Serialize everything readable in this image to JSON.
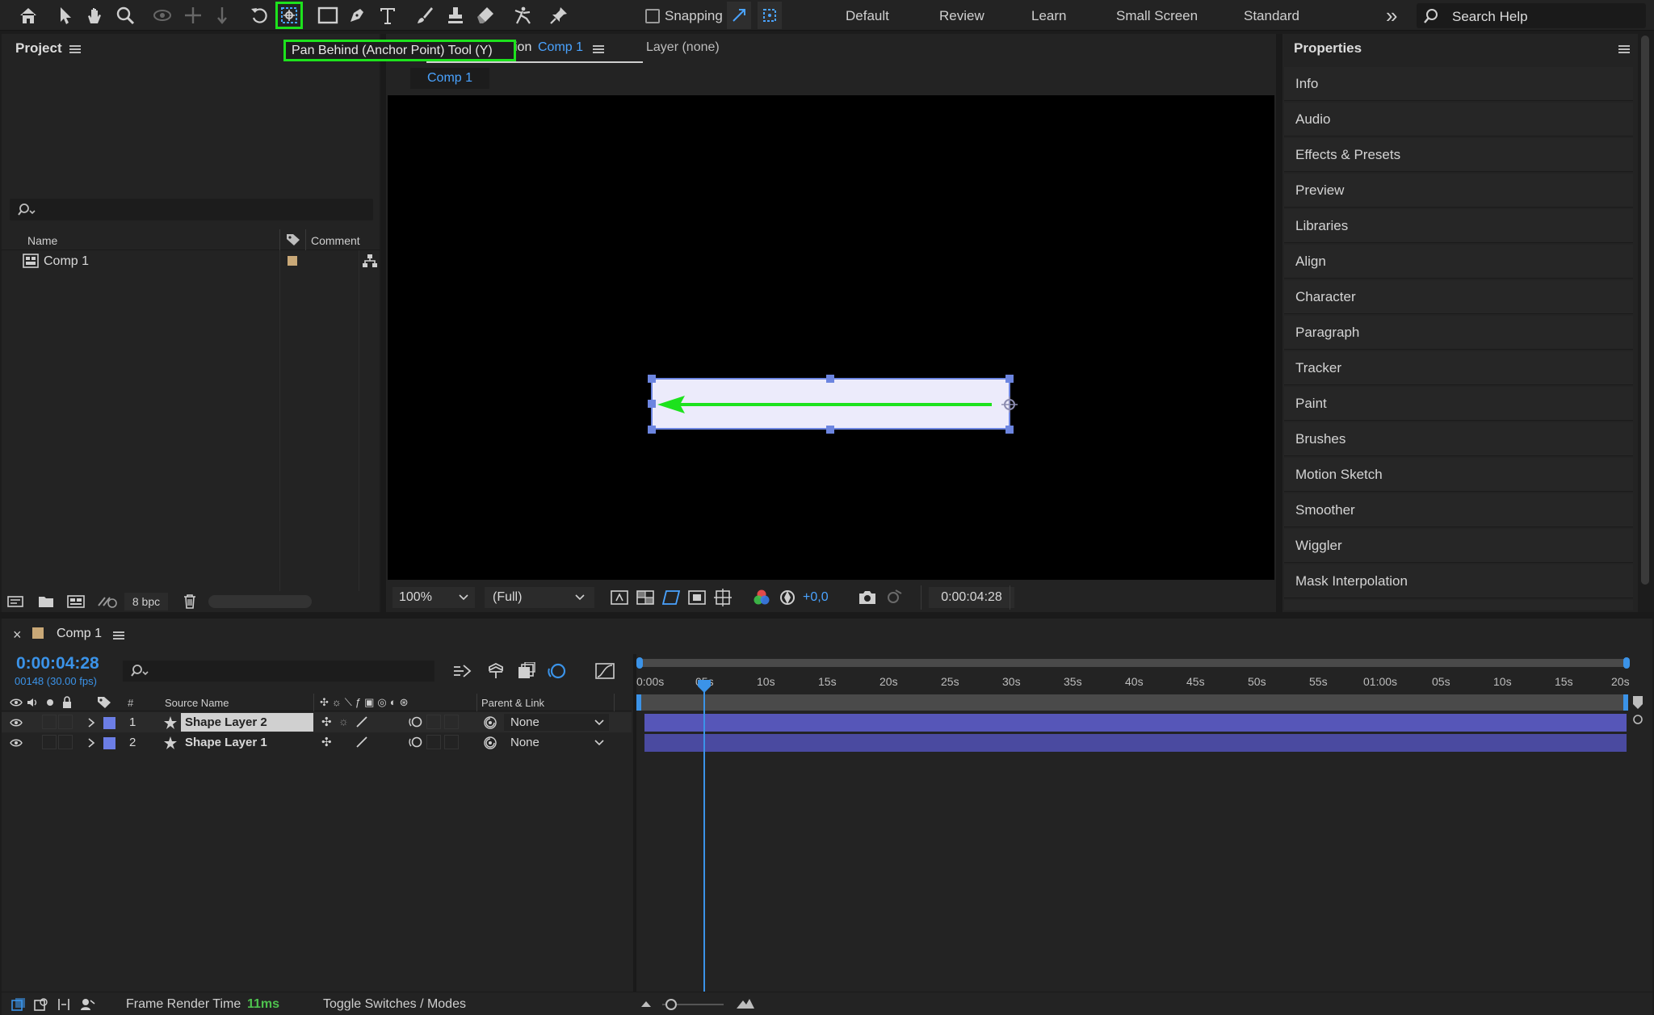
{
  "toolbar": {
    "tooltip": "Pan Behind (Anchor Point) Tool (Y)",
    "snapping_label": "Snapping",
    "workspaces": [
      "Default",
      "Review",
      "Learn",
      "Small Screen",
      "Standard"
    ],
    "more": "»",
    "search_placeholder": "Search Help"
  },
  "project": {
    "title": "Project",
    "col_name": "Name",
    "col_comment": "Comment",
    "items": [
      {
        "name": "Comp 1"
      }
    ],
    "bpc": "8 bpc"
  },
  "composition": {
    "tab_partial": "ion",
    "tab_comp": "Comp 1",
    "layer_tab": "Layer (none)",
    "sub_tab": "Comp 1",
    "zoom": "100%",
    "quality": "(Full)",
    "exposure": "+0,0",
    "timecode": "0:00:04:28"
  },
  "properties": {
    "title": "Properties",
    "items": [
      "Info",
      "Audio",
      "Effects & Presets",
      "Preview",
      "Libraries",
      "Align",
      "Character",
      "Paragraph",
      "Tracker",
      "Paint",
      "Brushes",
      "Motion Sketch",
      "Smoother",
      "Wiggler",
      "Mask Interpolation"
    ]
  },
  "timeline": {
    "comp_name": "Comp 1",
    "timecode": "0:00:04:28",
    "frame_info": "00148 (30.00 fps)",
    "col_num": "#",
    "col_source": "Source Name",
    "col_parent": "Parent & Link",
    "ruler": [
      "0:00s",
      "05s",
      "10s",
      "15s",
      "20s",
      "25s",
      "30s",
      "35s",
      "40s",
      "45s",
      "50s",
      "55s",
      "01:00s",
      "05s",
      "10s",
      "15s",
      "20s"
    ],
    "layers": [
      {
        "num": "1",
        "name": "Shape Layer 2",
        "parent": "None"
      },
      {
        "num": "2",
        "name": "Shape Layer 1",
        "parent": "None"
      }
    ],
    "status_label": "Frame Render Time",
    "render_time": "11ms",
    "toggle_label": "Toggle Switches / Modes"
  },
  "colors": {
    "accent_blue": "#3b93e8",
    "highlight_green": "#1de21d",
    "layer_bar": "#5050a8",
    "layer_label": "#6c7ee6"
  }
}
